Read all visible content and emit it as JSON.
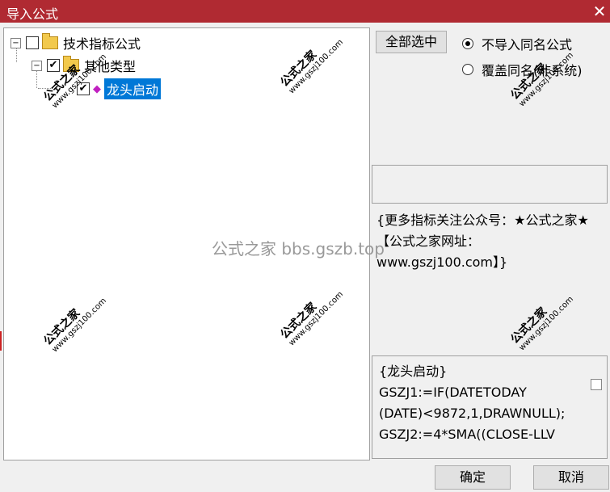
{
  "window": {
    "title": "导入公式",
    "close_glyph": "✕"
  },
  "tree": {
    "root": {
      "label": "技术指标公式",
      "expander": "−"
    },
    "child": {
      "label": "其他类型",
      "expander": "−"
    },
    "leaf": {
      "label": "龙头启动",
      "checked": true
    }
  },
  "buttons": {
    "select_all": "全部选中",
    "ok": "确定",
    "cancel": "取消"
  },
  "options": {
    "no_import_same": "不导入同名公式",
    "overwrite_same": "覆盖同名(非系统)"
  },
  "description": "{更多指标关注公众号：★公式之家★ 【公式之家网址：www.gszj100.com】}",
  "code": {
    "lines": [
      "{龙头启动}",
      "GSZJ1:=IF(DATETODAY",
      "(DATE)<9872,1,DRAWNULL);",
      "GSZJ2:=4*SMA((CLOSE-LLV"
    ]
  },
  "watermarks": {
    "brand": "公式之家",
    "url": "www.gszj100.com",
    "center": "公式之家 bbs.gszb.top"
  }
}
